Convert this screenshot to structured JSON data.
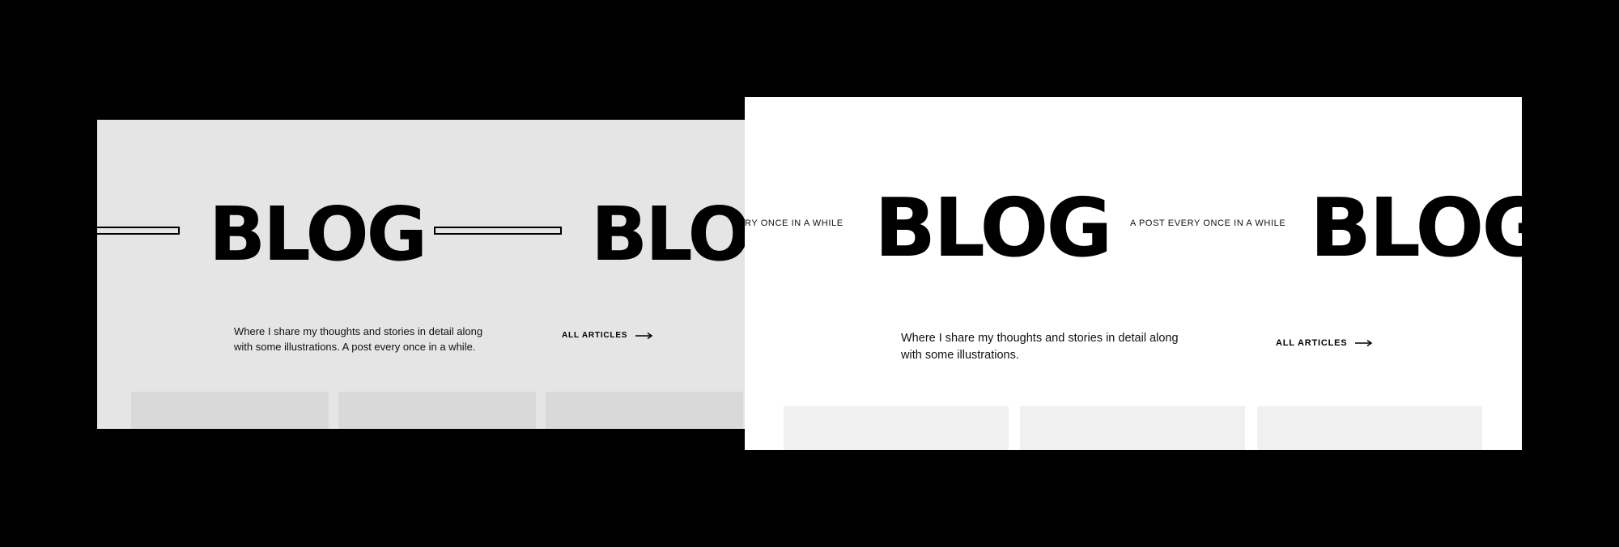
{
  "left_screen": {
    "blog_title": "BLOG",
    "blog_title_repeat": "BLOG",
    "description": "Where I share my thoughts and stories in detail along with some illustrations. A post every once in a while.",
    "all_articles_label": "ALL ARTICLES",
    "background_color": "#e5e5e5"
  },
  "right_screen": {
    "tagline_partial": "RY ONCE IN A WHILE",
    "blog_title": "BLOG",
    "tagline": "A POST EVERY ONCE IN A WHILE",
    "blog_title_repeat": "BLOG",
    "description": "Where I share my thoughts and stories in detail along with some illustrations.",
    "all_articles_label": "ALL ARTICLES",
    "background_color": "#ffffff"
  },
  "icons": {
    "arrow": "arrow-right-icon"
  }
}
